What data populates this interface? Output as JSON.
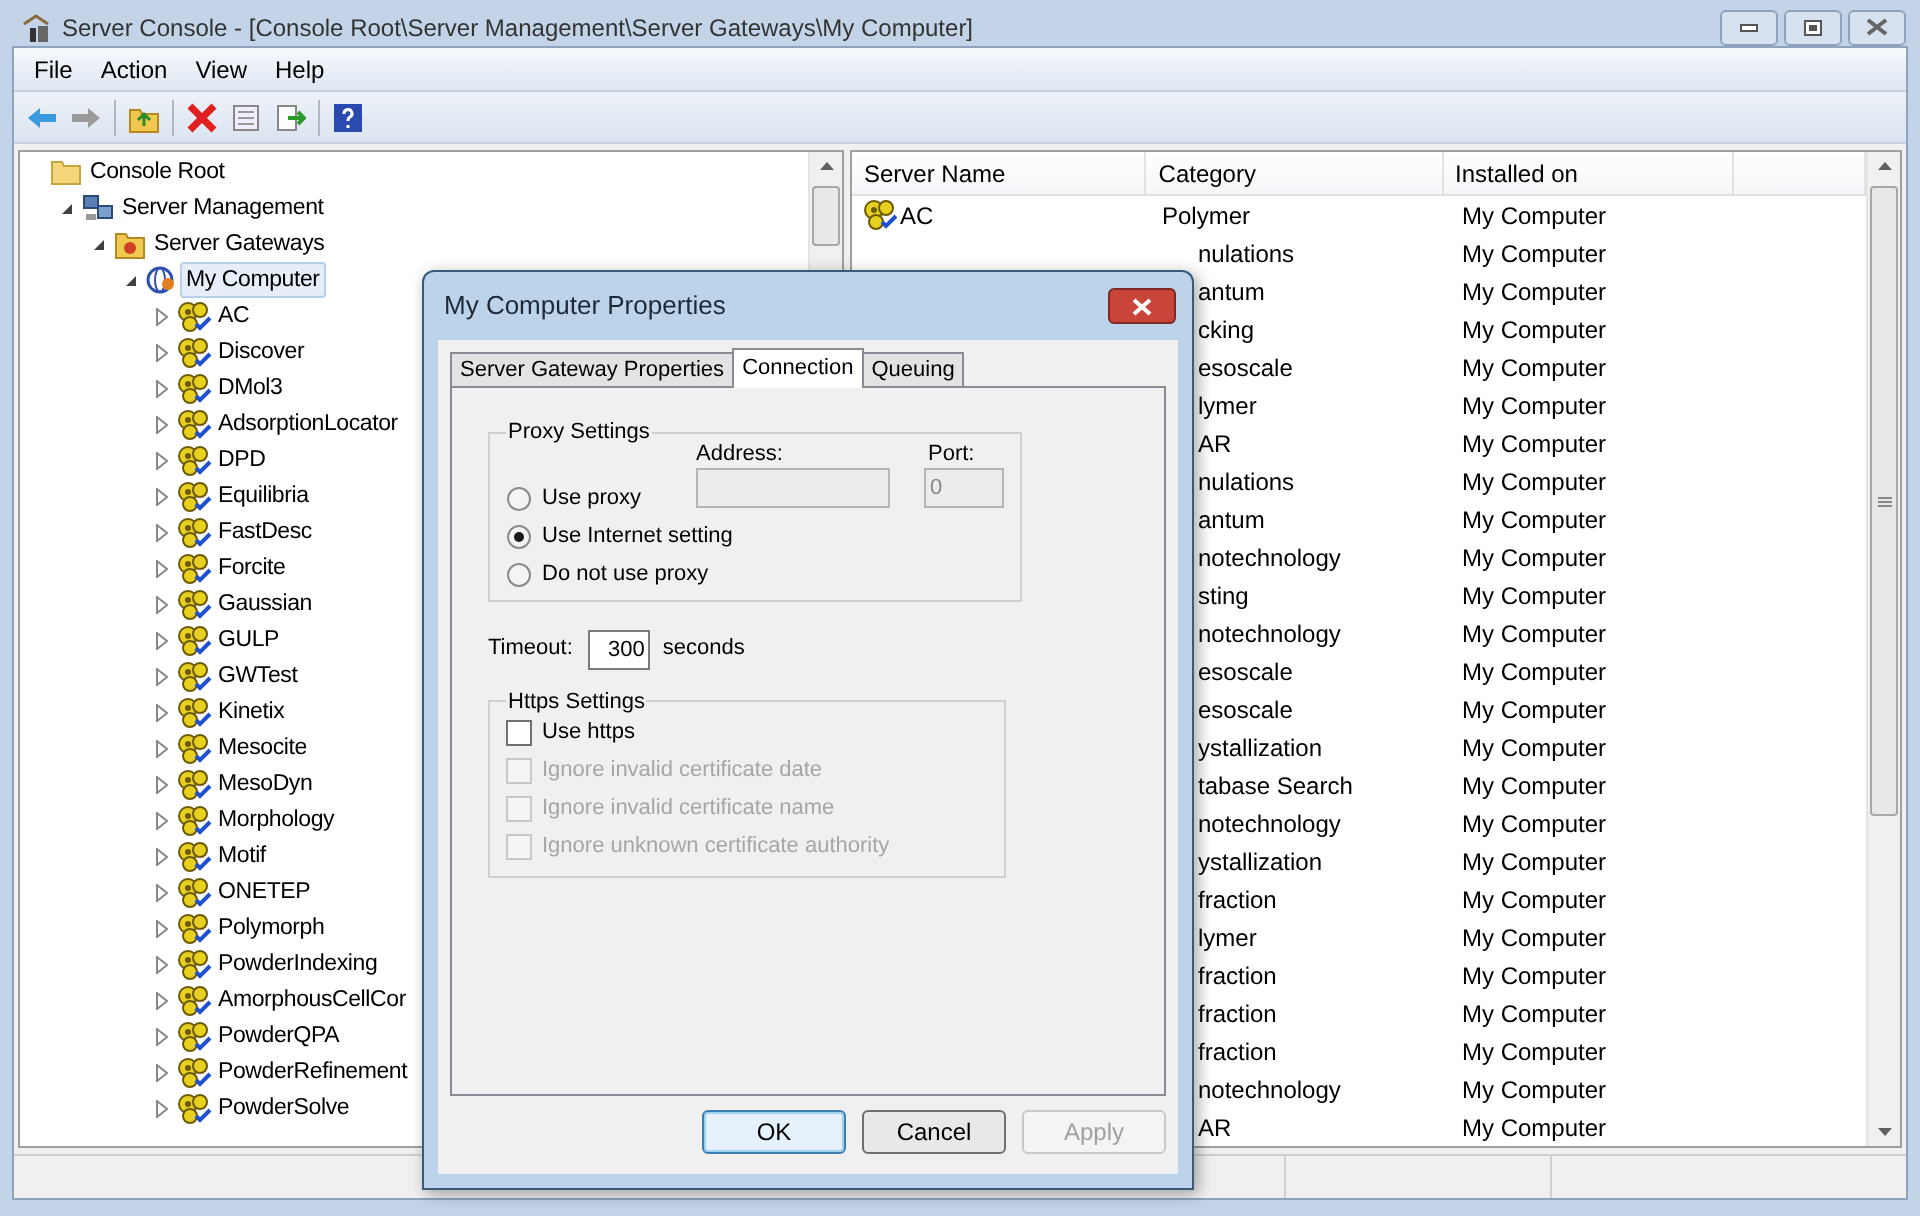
{
  "window": {
    "title": "Server Console - [Console Root\\Server Management\\Server Gateways\\My Computer]"
  },
  "menu": [
    "File",
    "Action",
    "View",
    "Help"
  ],
  "tree": {
    "label": "Console Root",
    "kind": "folder",
    "selected": false,
    "children": [
      {
        "label": "Server Management",
        "kind": "server",
        "expanded": true,
        "selected": false,
        "children": [
          {
            "label": "Server Gateways",
            "kind": "gateway",
            "expanded": true,
            "selected": false,
            "children": [
              {
                "label": "My Computer",
                "kind": "computer",
                "expanded": true,
                "selected": true,
                "children": [
                  {
                    "label": "AC",
                    "kind": "module",
                    "expanded": false,
                    "selected": false
                  },
                  {
                    "label": "Discover",
                    "kind": "module",
                    "expanded": false,
                    "selected": false
                  },
                  {
                    "label": "DMol3",
                    "kind": "module",
                    "expanded": false,
                    "selected": false
                  },
                  {
                    "label": "AdsorptionLocator",
                    "kind": "module",
                    "expanded": false,
                    "selected": false
                  },
                  {
                    "label": "DPD",
                    "kind": "module",
                    "expanded": false,
                    "selected": false
                  },
                  {
                    "label": "Equilibria",
                    "kind": "module",
                    "expanded": false,
                    "selected": false
                  },
                  {
                    "label": "FastDesc",
                    "kind": "module",
                    "expanded": false,
                    "selected": false
                  },
                  {
                    "label": "Forcite",
                    "kind": "module",
                    "expanded": false,
                    "selected": false
                  },
                  {
                    "label": "Gaussian",
                    "kind": "module",
                    "expanded": false,
                    "selected": false
                  },
                  {
                    "label": "GULP",
                    "kind": "module",
                    "expanded": false,
                    "selected": false
                  },
                  {
                    "label": "GWTest",
                    "kind": "module",
                    "expanded": false,
                    "selected": false
                  },
                  {
                    "label": "Kinetix",
                    "kind": "module",
                    "expanded": false,
                    "selected": false
                  },
                  {
                    "label": "Mesocite",
                    "kind": "module",
                    "expanded": false,
                    "selected": false
                  },
                  {
                    "label": "MesoDyn",
                    "kind": "module",
                    "expanded": false,
                    "selected": false
                  },
                  {
                    "label": "Morphology",
                    "kind": "module",
                    "expanded": false,
                    "selected": false
                  },
                  {
                    "label": "Motif",
                    "kind": "module",
                    "expanded": false,
                    "selected": false
                  },
                  {
                    "label": "ONETEP",
                    "kind": "module",
                    "expanded": false,
                    "selected": false
                  },
                  {
                    "label": "Polymorph",
                    "kind": "module",
                    "expanded": false,
                    "selected": false
                  },
                  {
                    "label": "PowderIndexing",
                    "kind": "module",
                    "expanded": false,
                    "selected": false
                  },
                  {
                    "label": "AmorphousCellCor",
                    "kind": "module",
                    "expanded": false,
                    "selected": false
                  },
                  {
                    "label": "PowderQPA",
                    "kind": "module",
                    "expanded": false,
                    "selected": false
                  },
                  {
                    "label": "PowderRefinement",
                    "kind": "module",
                    "expanded": false,
                    "selected": false
                  },
                  {
                    "label": "PowderSolve",
                    "kind": "module",
                    "expanded": false,
                    "selected": false
                  }
                ]
              }
            ]
          }
        ]
      }
    ]
  },
  "list": {
    "columns": [
      "Server Name",
      "Category",
      "Installed on"
    ],
    "rows": [
      {
        "server_name": "AC",
        "category": "Polymer",
        "installed_on": "My Computer"
      },
      {
        "category": "nulations",
        "installed_on": "My Computer"
      },
      {
        "category": "antum",
        "installed_on": "My Computer"
      },
      {
        "category": "cking",
        "installed_on": "My Computer"
      },
      {
        "category": "esoscale",
        "installed_on": "My Computer"
      },
      {
        "category": "lymer",
        "installed_on": "My Computer"
      },
      {
        "category": "AR",
        "installed_on": "My Computer"
      },
      {
        "category": "nulations",
        "installed_on": "My Computer"
      },
      {
        "category": "antum",
        "installed_on": "My Computer"
      },
      {
        "category": "notechnology",
        "installed_on": "My Computer"
      },
      {
        "category": "sting",
        "installed_on": "My Computer"
      },
      {
        "category": "notechnology",
        "installed_on": "My Computer"
      },
      {
        "category": "esoscale",
        "installed_on": "My Computer"
      },
      {
        "category": "esoscale",
        "installed_on": "My Computer"
      },
      {
        "category": "ystallization",
        "installed_on": "My Computer"
      },
      {
        "category": "tabase Search",
        "installed_on": "My Computer"
      },
      {
        "category": "notechnology",
        "installed_on": "My Computer"
      },
      {
        "category": "ystallization",
        "installed_on": "My Computer"
      },
      {
        "category": "fraction",
        "installed_on": "My Computer"
      },
      {
        "category": "lymer",
        "installed_on": "My Computer"
      },
      {
        "category": "fraction",
        "installed_on": "My Computer"
      },
      {
        "category": "fraction",
        "installed_on": "My Computer"
      },
      {
        "category": "fraction",
        "installed_on": "My Computer"
      },
      {
        "category": "notechnology",
        "installed_on": "My Computer"
      },
      {
        "category": "AR",
        "installed_on": "My Computer"
      }
    ]
  },
  "dialog": {
    "title": "My Computer Properties",
    "tabs": [
      {
        "label": "Server Gateway Properties",
        "selected": false
      },
      {
        "label": "Connection",
        "selected": true
      },
      {
        "label": "Queuing",
        "selected": false
      }
    ],
    "proxy": {
      "title": "Proxy Settings",
      "address_label": "Address:",
      "port_label": "Port:",
      "port_value": "0",
      "fields_disabled": true,
      "options": [
        {
          "label": "Use proxy",
          "selected": false
        },
        {
          "label": "Use Internet setting",
          "selected": true
        },
        {
          "label": "Do not use proxy",
          "selected": false
        }
      ]
    },
    "timeout": {
      "label": "Timeout:",
      "value": "300",
      "unit": "seconds"
    },
    "https": {
      "title": "Https Settings",
      "options": [
        {
          "label": "Use https",
          "checked": false,
          "disabled": false
        },
        {
          "label": "Ignore invalid certificate date",
          "checked": false,
          "disabled": true
        },
        {
          "label": "Ignore invalid certificate name",
          "checked": false,
          "disabled": true
        },
        {
          "label": "Ignore unknown certificate authority",
          "checked": false,
          "disabled": true
        }
      ]
    },
    "buttons": [
      {
        "label": "OK",
        "kind": "default",
        "disabled": false
      },
      {
        "label": "Cancel",
        "kind": "normal",
        "disabled": false
      },
      {
        "label": "Apply",
        "kind": "normal",
        "disabled": true
      }
    ]
  }
}
